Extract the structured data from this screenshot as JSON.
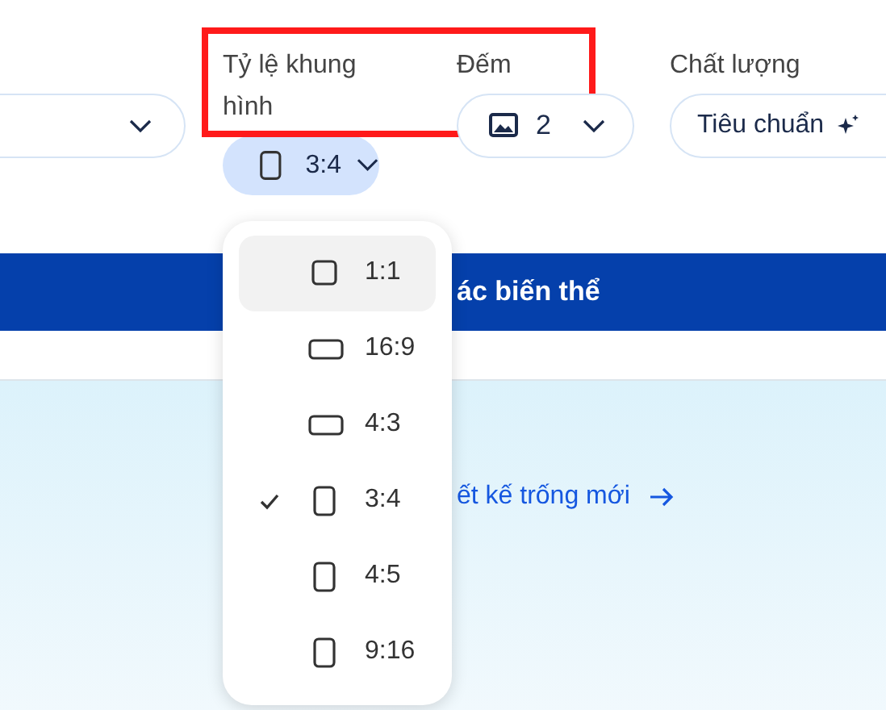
{
  "settings": [
    {
      "kind": "blank"
    },
    {
      "kind": "aspect",
      "label": "Tỷ lệ khung hình",
      "value": "3:4",
      "expanded": true
    },
    {
      "kind": "count",
      "label": "Đếm",
      "value": "2"
    },
    {
      "kind": "quality",
      "label": "Chất lượng",
      "value": "Tiêu chuẩn"
    }
  ],
  "generate_button": {
    "label": "ác biến thể"
  },
  "blank_design_link": {
    "label": "ết kế trống mới"
  },
  "aspect_menu": [
    {
      "label": "1:1",
      "kind": "square",
      "selected": false,
      "highlighted": true
    },
    {
      "label": "16:9",
      "kind": "landscape",
      "selected": false,
      "highlighted": false
    },
    {
      "label": "4:3",
      "kind": "landscape",
      "selected": false,
      "highlighted": false
    },
    {
      "label": "3:4",
      "kind": "portrait",
      "selected": true,
      "highlighted": false
    },
    {
      "label": "4:5",
      "kind": "portrait",
      "selected": false,
      "highlighted": false
    },
    {
      "label": "9:16",
      "kind": "portrait",
      "selected": false,
      "highlighted": false
    }
  ]
}
